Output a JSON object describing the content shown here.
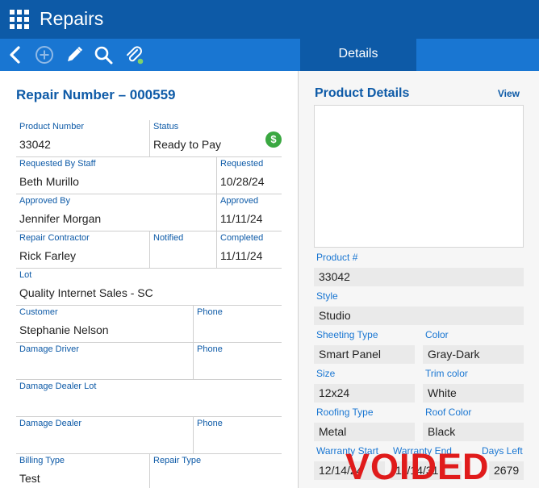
{
  "app": {
    "title": "Repairs"
  },
  "toolbar": {
    "tab_details": "Details"
  },
  "form": {
    "title": "Repair Number – 000559",
    "product_number": {
      "label": "Product Number",
      "value": "33042"
    },
    "status": {
      "label": "Status",
      "value": "Ready to Pay"
    },
    "requested_by_staff": {
      "label": "Requested By Staff",
      "value": "Beth Murillo"
    },
    "requested": {
      "label": "Requested",
      "value": "10/28/24"
    },
    "approved_by": {
      "label": "Approved By",
      "value": "Jennifer Morgan"
    },
    "approved": {
      "label": "Approved",
      "value": "11/11/24"
    },
    "repair_contractor": {
      "label": "Repair Contractor",
      "value": "Rick Farley"
    },
    "notified": {
      "label": "Notified",
      "value": ""
    },
    "completed": {
      "label": "Completed",
      "value": "11/11/24"
    },
    "lot": {
      "label": "Lot",
      "value": "Quality Internet Sales - SC"
    },
    "customer": {
      "label": "Customer",
      "value": "Stephanie Nelson"
    },
    "customer_phone": {
      "label": "Phone",
      "value": ""
    },
    "damage_driver": {
      "label": "Damage Driver",
      "value": ""
    },
    "damage_driver_phone": {
      "label": "Phone",
      "value": ""
    },
    "damage_dealer_lot": {
      "label": "Damage Dealer Lot",
      "value": ""
    },
    "damage_dealer": {
      "label": "Damage Dealer",
      "value": ""
    },
    "damage_dealer_phone": {
      "label": "Phone",
      "value": ""
    },
    "billing_type": {
      "label": "Billing Type",
      "value": "Test"
    },
    "repair_type": {
      "label": "Repair Type",
      "value": ""
    }
  },
  "product_details": {
    "title": "Product Details",
    "view_link": "View",
    "product_num": {
      "label": "Product #",
      "value": "33042"
    },
    "style": {
      "label": "Style",
      "value": "Studio"
    },
    "sheeting_type": {
      "label": "Sheeting Type",
      "value": "Smart Panel"
    },
    "color": {
      "label": "Color",
      "value": "Gray-Dark"
    },
    "size": {
      "label": "Size",
      "value": "12x24"
    },
    "trim_color": {
      "label": "Trim color",
      "value": "White"
    },
    "roofing_type": {
      "label": "Roofing Type",
      "value": "Metal"
    },
    "roof_color": {
      "label": "Roof Color",
      "value": "Black"
    },
    "warranty_start": {
      "label": "Warranty Start",
      "value": "12/14/24"
    },
    "warranty_end": {
      "label": "Warranty End",
      "value": "11/14/31"
    },
    "days_left": {
      "label": "Days Left",
      "value": "2679"
    },
    "voided_stamp": "VOIDED"
  },
  "colors": {
    "header": "#0d5aa7",
    "toolbar": "#1976d2",
    "status_paid": "#3aa841",
    "voided": "#e01b1b"
  },
  "icons": [
    "apps-grid-icon",
    "back-icon",
    "add-circle-icon",
    "edit-pencil-icon",
    "search-icon",
    "attachment-icon"
  ]
}
